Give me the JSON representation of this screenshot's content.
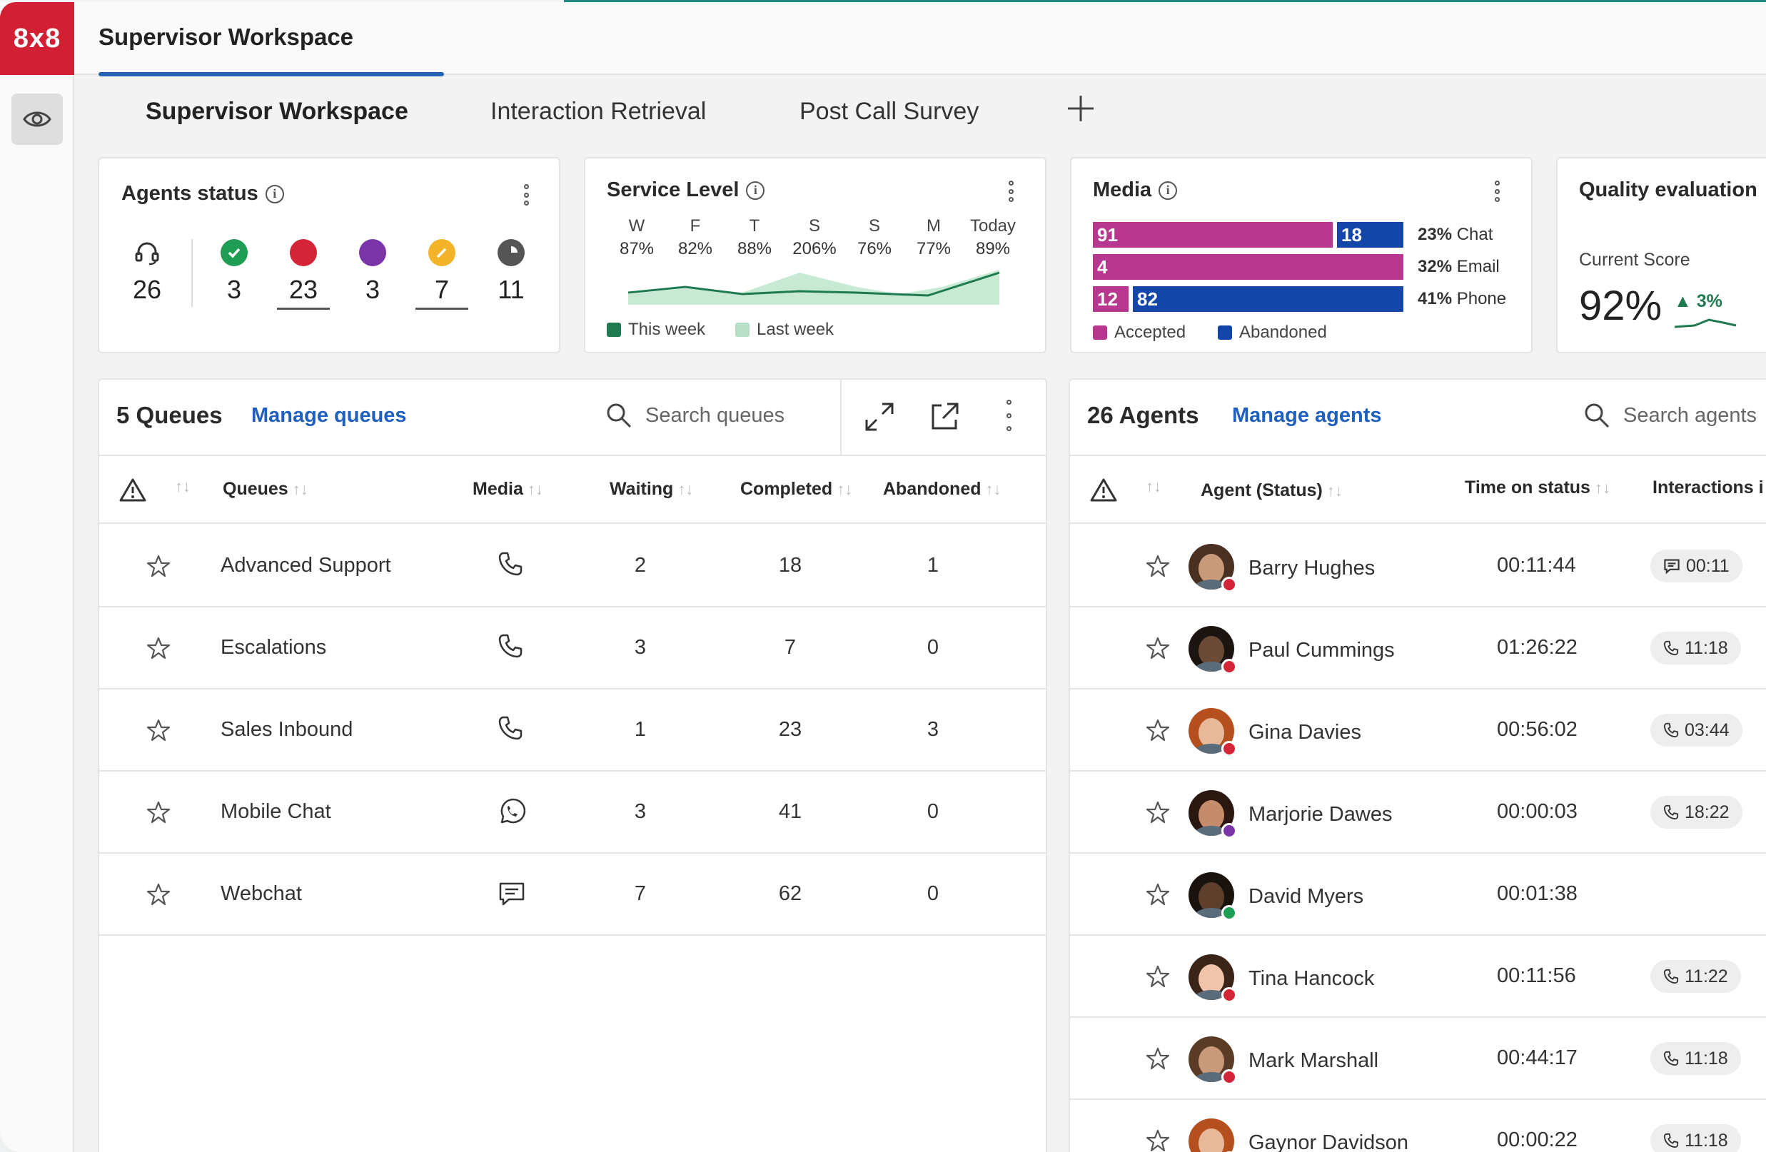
{
  "app": {
    "logo": "8x8",
    "title": "Supervisor Workspace"
  },
  "tabs": [
    {
      "label": "Supervisor Workspace",
      "active": true
    },
    {
      "label": "Interaction Retrieval"
    },
    {
      "label": "Post Call Survey"
    }
  ],
  "agents_status": {
    "title": "Agents status",
    "total": "26",
    "counts": [
      {
        "icon": "check-icon",
        "color": "#1f9d55",
        "value": "3"
      },
      {
        "icon": "busy-dot-icon",
        "color": "#d32438",
        "value": "23"
      },
      {
        "icon": "away-dot-icon",
        "color": "#7b33a8",
        "value": "3"
      },
      {
        "icon": "pencil-icon",
        "color": "#f4b42a",
        "value": "7"
      },
      {
        "icon": "clock-icon",
        "color": "#555555",
        "value": "11"
      }
    ]
  },
  "service_level": {
    "title": "Service Level",
    "days": [
      {
        "day": "W",
        "pct": "87%"
      },
      {
        "day": "F",
        "pct": "82%"
      },
      {
        "day": "T",
        "pct": "88%"
      },
      {
        "day": "S",
        "pct": "206%"
      },
      {
        "day": "S",
        "pct": "76%"
      },
      {
        "day": "M",
        "pct": "77%"
      },
      {
        "day": "Today",
        "pct": "89%"
      }
    ],
    "legend": {
      "this_week": "This week",
      "last_week": "Last week"
    },
    "colors": {
      "this_week": "#1f7a4f",
      "last_week": "#b7dfc5"
    }
  },
  "media": {
    "title": "Media",
    "rows": [
      {
        "accepted": "91",
        "abandoned": "18",
        "label_pct": "23%",
        "label": "Chat"
      },
      {
        "accepted": "4",
        "abandoned": "",
        "label_pct": "32%",
        "label": "Email"
      },
      {
        "accepted": "12",
        "abandoned": "82",
        "label_pct": "41%",
        "label": "Phone"
      }
    ],
    "legend": {
      "accepted": "Accepted",
      "abandoned": "Abandoned"
    },
    "colors": {
      "accepted": "#b8388f",
      "abandoned": "#1346a8"
    }
  },
  "quality": {
    "title": "Quality evaluation",
    "subtitle": "Current Score",
    "score": "92%",
    "delta": "3%"
  },
  "queues": {
    "title": "5 Queues",
    "manage": "Manage queues",
    "search_placeholder": "Search queues",
    "columns": {
      "queues": "Queues",
      "media": "Media",
      "waiting": "Waiting",
      "completed": "Completed",
      "abandoned": "Abandoned"
    },
    "rows": [
      {
        "name": "Advanced Support",
        "media": "phone-icon",
        "waiting": "2",
        "completed": "18",
        "abandoned": "1"
      },
      {
        "name": "Escalations",
        "media": "phone-icon",
        "waiting": "3",
        "completed": "7",
        "abandoned": "0"
      },
      {
        "name": "Sales Inbound",
        "media": "phone-icon",
        "waiting": "1",
        "completed": "23",
        "abandoned": "3"
      },
      {
        "name": "Mobile Chat",
        "media": "whatsapp-icon",
        "waiting": "3",
        "completed": "41",
        "abandoned": "0"
      },
      {
        "name": "Webchat",
        "media": "chat-icon",
        "waiting": "7",
        "completed": "62",
        "abandoned": "0"
      }
    ]
  },
  "agents": {
    "title": "26 Agents",
    "manage": "Manage agents",
    "search_placeholder": "Search agents",
    "columns": {
      "agent": "Agent (Status)",
      "time": "Time on status",
      "interactions": "Interactions i"
    },
    "rows": [
      {
        "name": "Barry Hughes",
        "time": "00:11:44",
        "chip_icon": "chat-icon",
        "chip": "00:11",
        "status_color": "#d32438",
        "skin": "#c99a7a",
        "hair": "#4a3020"
      },
      {
        "name": "Paul Cummings",
        "time": "01:26:22",
        "chip_icon": "phone-icon",
        "chip": "11:18",
        "status_color": "#d32438",
        "skin": "#6b4a36",
        "hair": "#1c1410"
      },
      {
        "name": "Gina Davies",
        "time": "00:56:02",
        "chip_icon": "phone-icon",
        "chip": "03:44",
        "status_color": "#d32438",
        "skin": "#e8b89a",
        "hair": "#b5501e"
      },
      {
        "name": "Marjorie Dawes",
        "time": "00:00:03",
        "chip_icon": "phone-icon",
        "chip": "18:22",
        "status_color": "#7b33a8",
        "skin": "#c48c6a",
        "hair": "#2a1810"
      },
      {
        "name": "David Myers",
        "time": "00:01:38",
        "chip_icon": "",
        "chip": "",
        "status_color": "#1f9d55",
        "skin": "#5e3f2c",
        "hair": "#1a120c"
      },
      {
        "name": "Tina Hancock",
        "time": "00:11:56",
        "chip_icon": "phone-icon",
        "chip": "11:22",
        "status_color": "#d32438",
        "skin": "#f0c4aa",
        "hair": "#3a2418"
      },
      {
        "name": "Mark Marshall",
        "time": "00:44:17",
        "chip_icon": "phone-icon",
        "chip": "11:18",
        "status_color": "#d32438",
        "skin": "#c99a7a",
        "hair": "#5a3b26"
      },
      {
        "name": "Gaynor Davidson",
        "time": "00:00:22",
        "chip_icon": "phone-icon",
        "chip": "11:18",
        "status_color": "#d32438",
        "skin": "#e8b89a",
        "hair": "#b5501e"
      }
    ]
  }
}
